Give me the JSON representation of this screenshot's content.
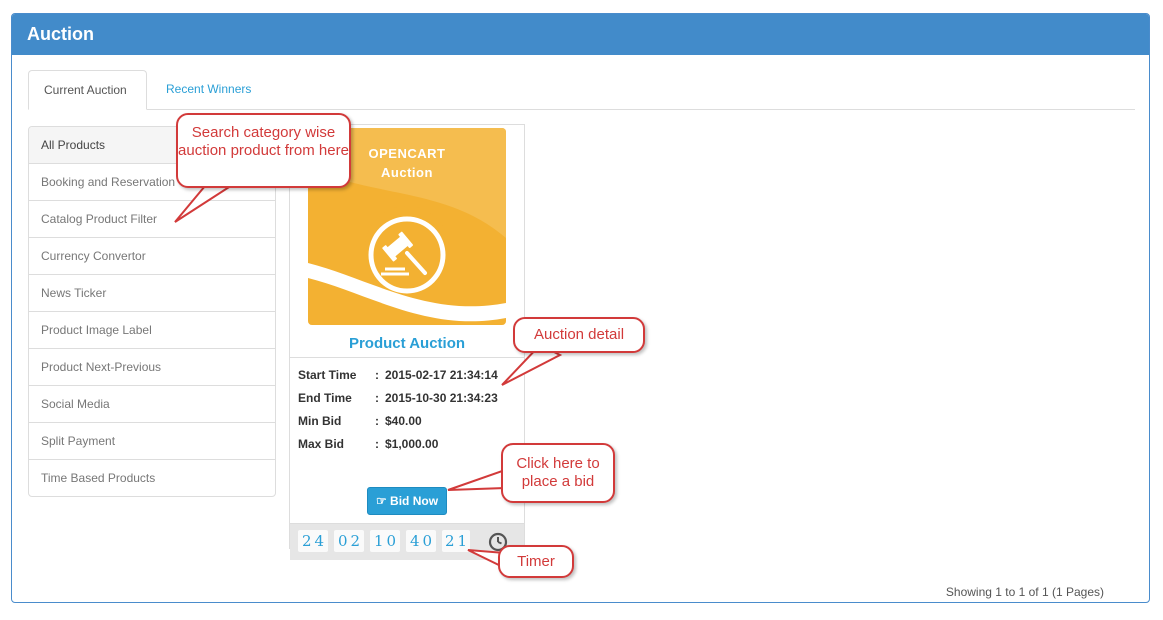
{
  "panel": {
    "title": "Auction"
  },
  "tabs": [
    {
      "label": "Current Auction",
      "active": true
    },
    {
      "label": "Recent Winners",
      "active": false
    }
  ],
  "categories": [
    "All Products",
    "Booking and Reservation",
    "Catalog Product Filter",
    "Currency Convertor",
    "News Ticker",
    "Product Image Label",
    "Product Next-Previous",
    "Social Media",
    "Split Payment",
    "Time Based Products"
  ],
  "product": {
    "image_text_line1": "OPENCART",
    "image_text_line2": "Auction",
    "name": "Product Auction",
    "details": [
      {
        "label": "Start Time",
        "value": "2015-02-17 21:34:14"
      },
      {
        "label": "End Time",
        "value": "2015-10-30 21:34:23"
      },
      {
        "label": "Min Bid",
        "value": "$40.00"
      },
      {
        "label": "Max Bid",
        "value": "$1,000.00"
      }
    ],
    "bid_button": "Bid Now",
    "timer": [
      "24",
      "02",
      "10",
      "40",
      "21"
    ]
  },
  "pagination": {
    "text": "Showing 1 to 1 of 1 (1 Pages)"
  },
  "callouts": {
    "category": "Search category wise auction product from here",
    "detail": "Auction detail",
    "bid": "Click here to place a bid",
    "timer": "Timer"
  },
  "colors": {
    "header": "#428bca",
    "accent": "#2a9fd6",
    "image_orange": "#f3b132",
    "callout": "#d23a3a"
  },
  "icons": [
    "gavel-icon",
    "thumbs-up-icon",
    "clock-icon"
  ]
}
